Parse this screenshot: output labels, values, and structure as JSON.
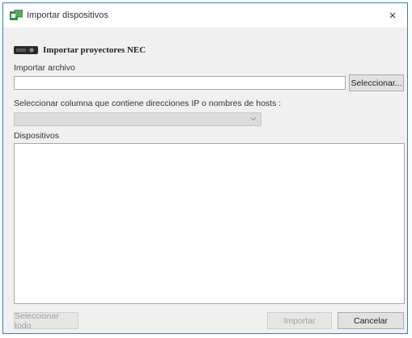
{
  "window": {
    "title": "Importar dispositivos",
    "close_glyph": "×",
    "app_icon": "import-devices-icon"
  },
  "header": {
    "badge_icon": "nec-projector-icon",
    "label": "Importar proyectores NEC"
  },
  "import_file": {
    "label": "Importar archivo",
    "value": "",
    "select_button": "Seleccionar..."
  },
  "column_select": {
    "label": "Seleccionar columna que contiene direcciones IP o nombres de hosts :",
    "selected": ""
  },
  "devices": {
    "label": "Dispositivos",
    "items": []
  },
  "footer": {
    "select_all": "Seleccionar todo",
    "import": "Importar",
    "cancel": "Cancelar"
  },
  "colors": {
    "window_border": "#2b7fc9",
    "dialog_background": "#f0f0f0",
    "app_icon_green": "#3a8c3f"
  }
}
